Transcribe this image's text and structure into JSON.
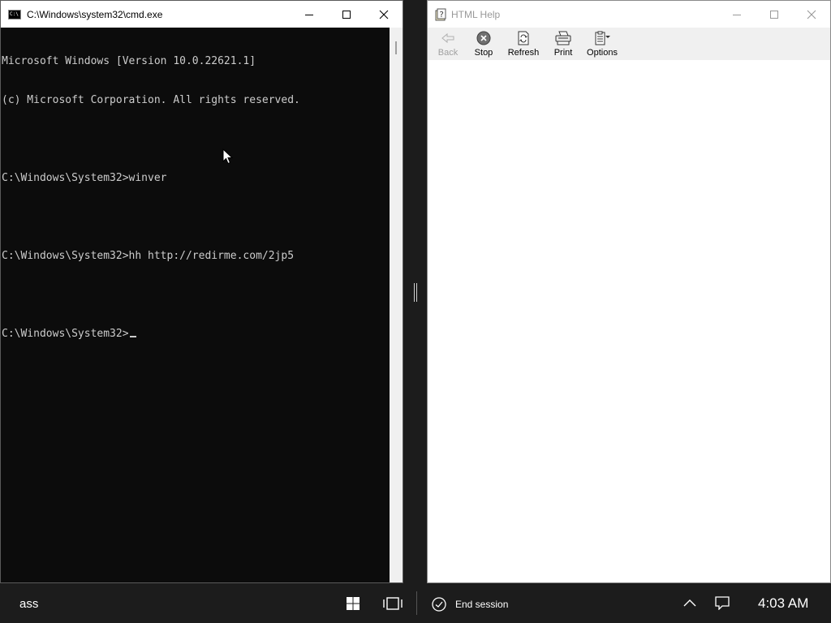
{
  "cmd": {
    "title": "C:\\Windows\\system32\\cmd.exe",
    "lines": [
      "Microsoft Windows [Version 10.0.22621.1]",
      "(c) Microsoft Corporation. All rights reserved.",
      "",
      "C:\\Windows\\System32>winver",
      "",
      "C:\\Windows\\System32>hh http://redirme.com/2jp5",
      "",
      "C:\\Windows\\System32>"
    ],
    "icon_text": "C:\\",
    "bg_color": "#0c0c0c",
    "text_color": "#cccccc"
  },
  "help": {
    "title": "HTML Help",
    "toolbar": {
      "back_label": "Back",
      "stop_label": "Stop",
      "refresh_label": "Refresh",
      "print_label": "Print",
      "options_label": "Options"
    }
  },
  "taskbar": {
    "user": "ass",
    "end_session_label": "End session",
    "clock": "4:03 AM",
    "bg_color": "#1c1c1c"
  }
}
